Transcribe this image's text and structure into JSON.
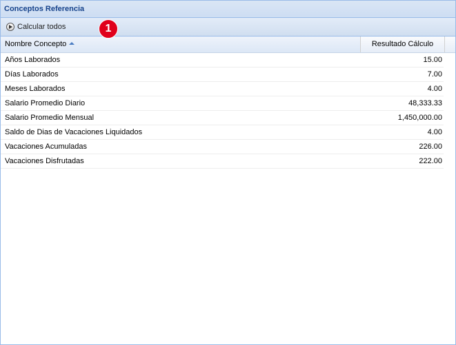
{
  "panel": {
    "title": "Conceptos Referencia"
  },
  "toolbar": {
    "calc_all_label": "Calcular todos",
    "badge": "1"
  },
  "grid": {
    "columns": {
      "name": "Nombre Concepto",
      "result": "Resultado Cálculo"
    },
    "sort": "ascending",
    "rows": [
      {
        "name": "Años Laborados",
        "value": "15.00"
      },
      {
        "name": "Días Laborados",
        "value": "7.00"
      },
      {
        "name": "Meses Laborados",
        "value": "4.00"
      },
      {
        "name": "Salario Promedio Diario",
        "value": "48,333.33"
      },
      {
        "name": "Salario Promedio Mensual",
        "value": "1,450,000.00"
      },
      {
        "name": "Saldo de Dias de Vacaciones Liquidados",
        "value": "4.00"
      },
      {
        "name": "Vacaciones Acumuladas",
        "value": "226.00"
      },
      {
        "name": "Vacaciones Disfrutadas",
        "value": "222.00"
      }
    ]
  },
  "colors": {
    "header_text": "#15428b",
    "border": "#99bbe8",
    "badge": "#e0001b"
  }
}
